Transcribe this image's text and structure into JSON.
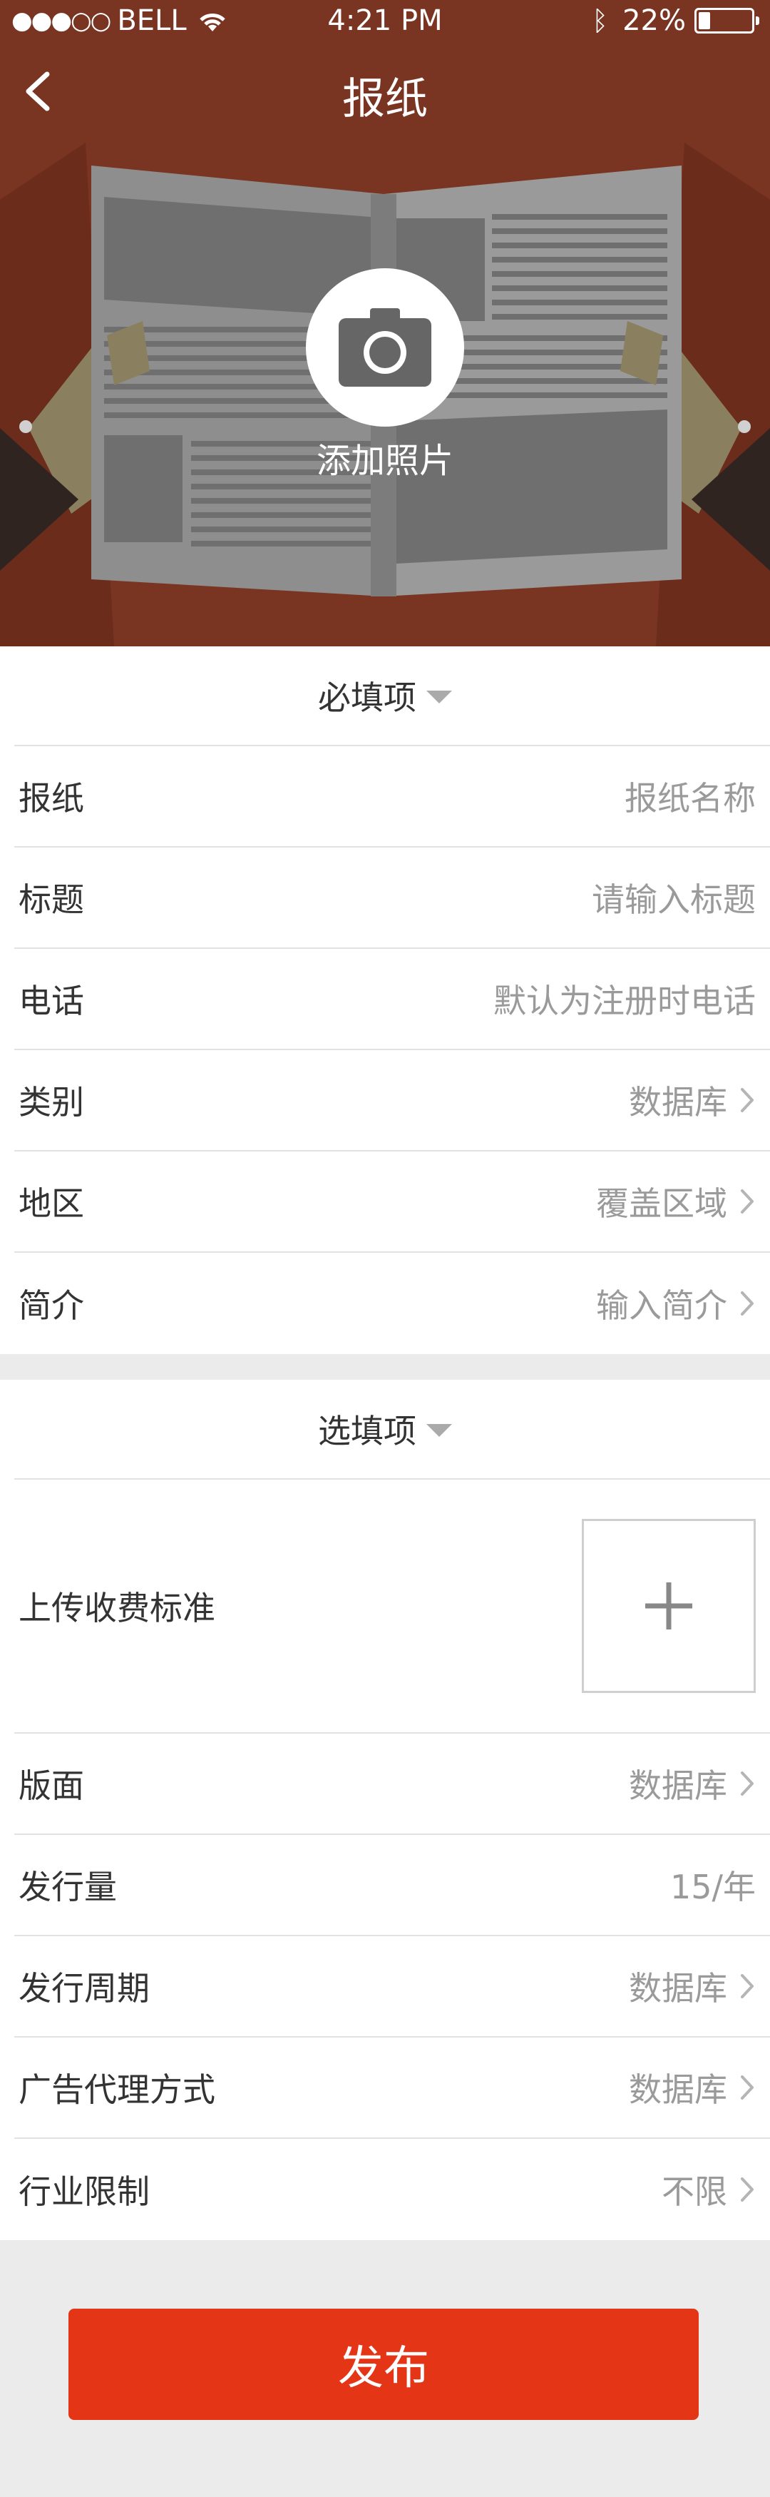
{
  "status_bar": {
    "carrier": "BELL",
    "time": "4:21 PM",
    "battery": "22%",
    "battery_level": 0.22
  },
  "nav": {
    "title": "报纸"
  },
  "hero": {
    "add_photo_label": "添加照片"
  },
  "required": {
    "header": "必填项",
    "rows": [
      {
        "label": "报纸",
        "value": "报纸名称",
        "chevron": false
      },
      {
        "label": "标题",
        "value": "请输入标题",
        "chevron": false
      },
      {
        "label": "电话",
        "value": "默认为注册时电话",
        "chevron": false
      },
      {
        "label": "类别",
        "value": "数据库",
        "chevron": true
      },
      {
        "label": "地区",
        "value": "覆盖区域",
        "chevron": true
      },
      {
        "label": "简介",
        "value": "输入简介",
        "chevron": true
      }
    ]
  },
  "optional": {
    "header": "选填项",
    "upload_label": "上传收费标准",
    "rows": [
      {
        "label": "版面",
        "value": "数据库",
        "chevron": true
      },
      {
        "label": "发行量",
        "value": "15/年",
        "chevron": false
      },
      {
        "label": "发行周期",
        "value": "数据库",
        "chevron": true
      },
      {
        "label": "广告代理方式",
        "value": "数据库",
        "chevron": true
      },
      {
        "label": "行业限制",
        "value": "不限",
        "chevron": true
      }
    ]
  },
  "publish_button": "发布",
  "colors": {
    "hero_bg": "#7a3422",
    "accent": "#e53517",
    "placeholder_text": "#9a9a9a"
  }
}
